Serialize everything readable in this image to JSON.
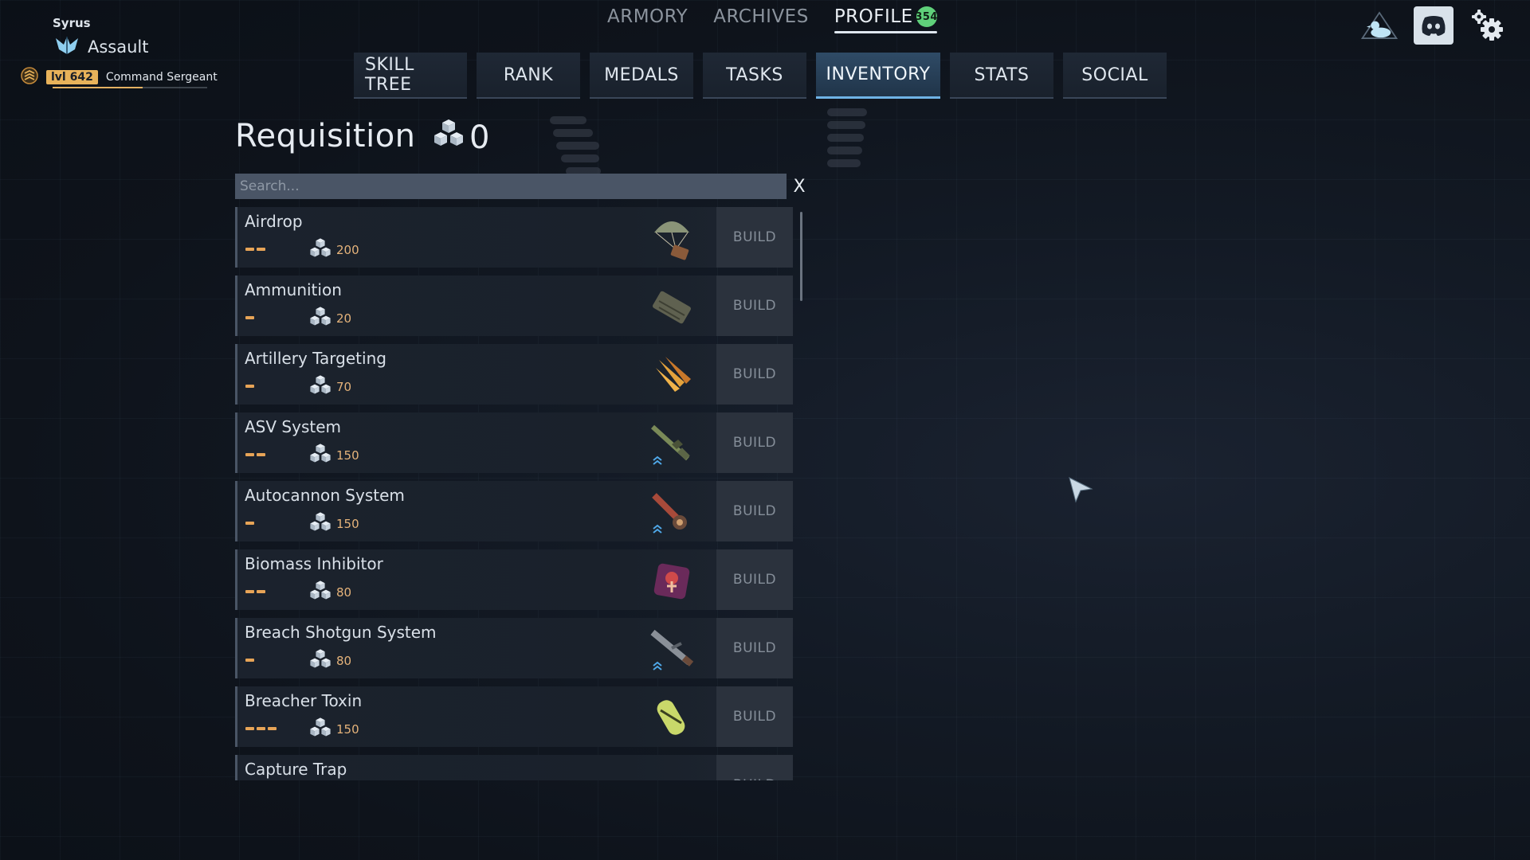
{
  "player": {
    "name": "Syrus",
    "class": "Assault",
    "level": "lvl 642",
    "rank": "Command Sergeant",
    "xp_fraction": 0.58
  },
  "top_nav": [
    {
      "label": "ARMORY",
      "active": false
    },
    {
      "label": "ARCHIVES",
      "active": false
    },
    {
      "label": "PROFILE",
      "active": true,
      "badge": "354"
    }
  ],
  "top_icons": [
    "duck-icon",
    "discord-icon",
    "settings-icon"
  ],
  "sub_tabs": [
    {
      "label": "SKILL TREE"
    },
    {
      "label": "RANK"
    },
    {
      "label": "MEDALS"
    },
    {
      "label": "TASKS"
    },
    {
      "label": "INVENTORY",
      "active": true
    },
    {
      "label": "STATS"
    },
    {
      "label": "SOCIAL"
    }
  ],
  "requisition": {
    "title": "Requisition",
    "resource_count": "0"
  },
  "search": {
    "placeholder": "Search...",
    "value": "",
    "clear_label": "X"
  },
  "build_label": "BUILD",
  "items": [
    {
      "name": "Airdrop",
      "tier": 2,
      "cost": "200",
      "icon": "parachute-crate-icon",
      "upgrade": false
    },
    {
      "name": "Ammunition",
      "tier": 1,
      "cost": "20",
      "icon": "ammo-case-icon",
      "upgrade": false
    },
    {
      "name": "Artillery Targeting",
      "tier": 1,
      "cost": "70",
      "icon": "artillery-shells-icon",
      "upgrade": false
    },
    {
      "name": "ASV System",
      "tier": 2,
      "cost": "150",
      "icon": "rifle-icon",
      "upgrade": true
    },
    {
      "name": "Autocannon System",
      "tier": 1,
      "cost": "150",
      "icon": "autocannon-icon",
      "upgrade": true
    },
    {
      "name": "Biomass Inhibitor",
      "tier": 2,
      "cost": "80",
      "icon": "biomass-inhibitor-icon",
      "upgrade": false
    },
    {
      "name": "Breach Shotgun System",
      "tier": 1,
      "cost": "80",
      "icon": "shotgun-icon",
      "upgrade": true
    },
    {
      "name": "Breacher Toxin",
      "tier": 3,
      "cost": "150",
      "icon": "toxin-canister-icon",
      "upgrade": false
    },
    {
      "name": "Capture Trap",
      "tier": 0,
      "cost": "",
      "icon": "capture-trap-icon",
      "upgrade": false
    }
  ],
  "colors": {
    "tier_bar": "#e7a457",
    "cost_text": "#e5b37a",
    "level_badge": "#e8b25a",
    "notification_badge": "#5fd07a",
    "active_tab": "#2f4b66"
  }
}
